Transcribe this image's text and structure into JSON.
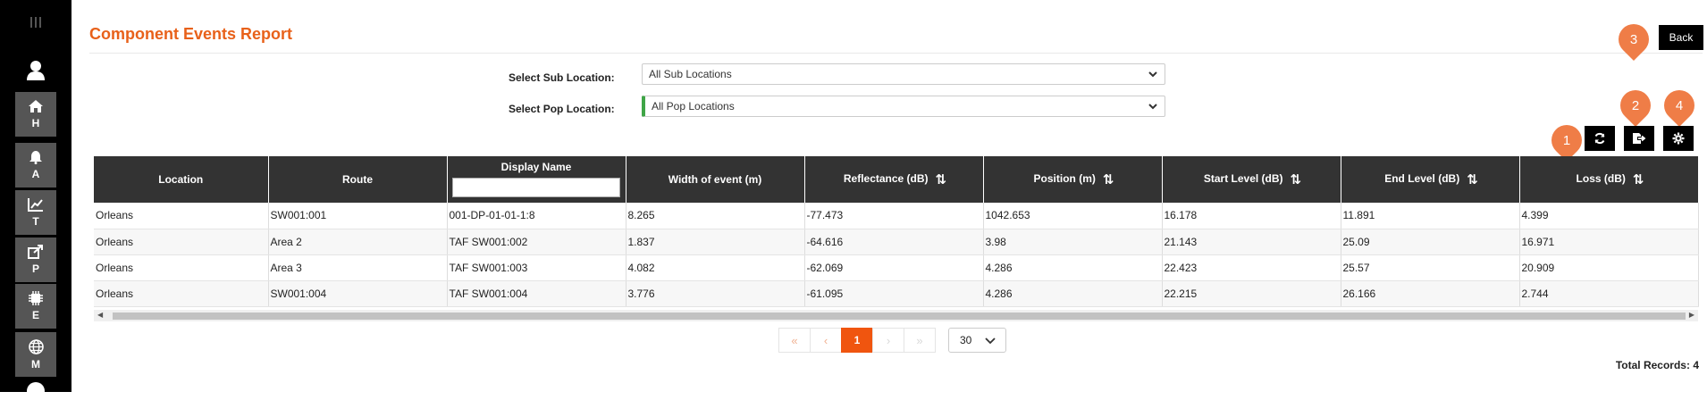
{
  "sidebar": {
    "items": [
      {
        "letter": "H",
        "icon": "home-icon"
      },
      {
        "letter": "A",
        "icon": "bell-icon"
      },
      {
        "letter": "T",
        "icon": "area-chart-icon"
      },
      {
        "letter": "P",
        "icon": "share-square-icon"
      },
      {
        "letter": "E",
        "icon": "chip-icon"
      },
      {
        "letter": "M",
        "icon": "globe-icon"
      }
    ]
  },
  "page": {
    "title": "Component Events Report",
    "back_label": "Back"
  },
  "badges": [
    "1",
    "2",
    "3",
    "4"
  ],
  "filters": {
    "sub_location_label": "Select Sub Location:",
    "sub_location_value": "All Sub Locations",
    "pop_location_label": "Select Pop Location:",
    "pop_location_value": "All Pop Locations"
  },
  "toolbar": {
    "refresh_icon": "refresh-icon",
    "export_icon": "export-icon",
    "settings_icon": "gear-icon"
  },
  "table": {
    "columns": [
      "Location",
      "Route",
      "Display Name",
      "Width of event (m)",
      "Reflectance (dB)",
      "Position (m)",
      "Start Level (dB)",
      "End Level (dB)",
      "Loss (dB)"
    ],
    "sort_glyph": "⇅",
    "rows": [
      [
        "Orleans",
        "SW001:001",
        "001-DP-01-01-1:8",
        "8.265",
        "-77.473",
        "1042.653",
        "16.178",
        "11.891",
        "4.399"
      ],
      [
        "Orleans",
        "Area 2",
        "TAF SW001:002",
        "1.837",
        "-64.616",
        "3.98",
        "21.143",
        "25.09",
        "16.971"
      ],
      [
        "Orleans",
        "Area 3",
        "TAF SW001:003",
        "4.082",
        "-62.069",
        "4.286",
        "22.423",
        "25.57",
        "20.909"
      ],
      [
        "Orleans",
        "SW001:004",
        "TAF SW001:004",
        "3.776",
        "-61.095",
        "4.286",
        "22.215",
        "26.166",
        "2.744"
      ]
    ]
  },
  "pagination": {
    "first": "«",
    "prev": "‹",
    "current": "1",
    "next": "›",
    "last": "»",
    "page_size": "30"
  },
  "footer": {
    "total_records": "Total Records: 4"
  }
}
